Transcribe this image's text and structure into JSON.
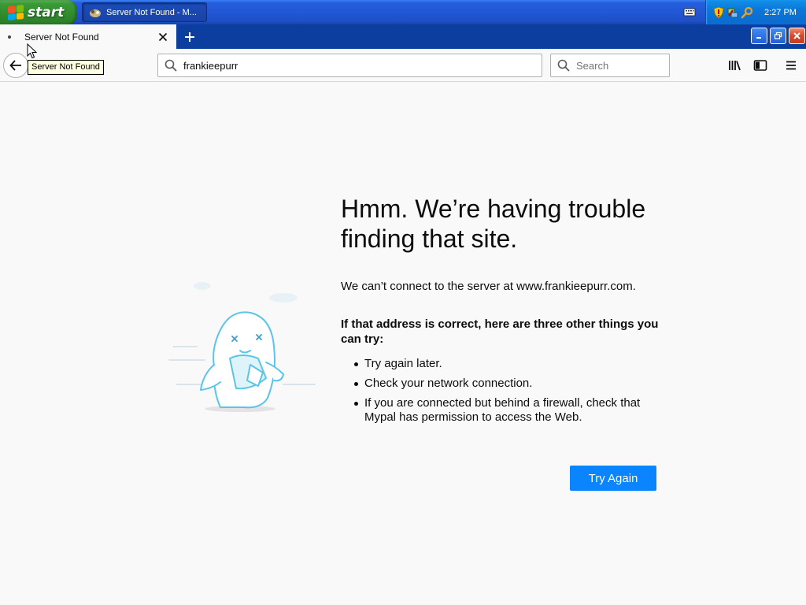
{
  "taskbar": {
    "start_label": "start",
    "task_title": "Server Not Found - M...",
    "clock": "2:27 PM",
    "icons": [
      "windows-flag-icon",
      "browser-task-icon",
      "keyboard-icon",
      "security-shield-icon",
      "network-icon",
      "search-key-icon"
    ]
  },
  "browser": {
    "tab_title": "Server Not Found",
    "tooltip": "Server Not Found",
    "url_value": "frankieepurr",
    "search_placeholder": "Search",
    "icons": [
      "back-arrow-icon",
      "close-icon",
      "plus-icon",
      "minimize-icon",
      "restore-icon",
      "library-icon",
      "sidebar-icon",
      "hamburger-menu-icon"
    ]
  },
  "error_page": {
    "title": "Hmm. We’re having trouble finding that site.",
    "description": "We can’t connect to the server at www.frankieepurr.com.",
    "subheading": "If that address is correct, here are three other things you can try:",
    "suggestions": [
      "Try again later.",
      "Check your network connection.",
      "If you are connected but behind a firewall, check that Mypal has permission to access the Web."
    ],
    "try_again_label": "Try Again"
  },
  "colors": {
    "taskbar_blue": "#245edc",
    "start_green": "#3c9a38",
    "tabstrip_blue": "#0b3e9e",
    "primary_button": "#0a84ff",
    "page_background": "#f9f9fa",
    "illustration_stroke": "#5bc4e8"
  }
}
